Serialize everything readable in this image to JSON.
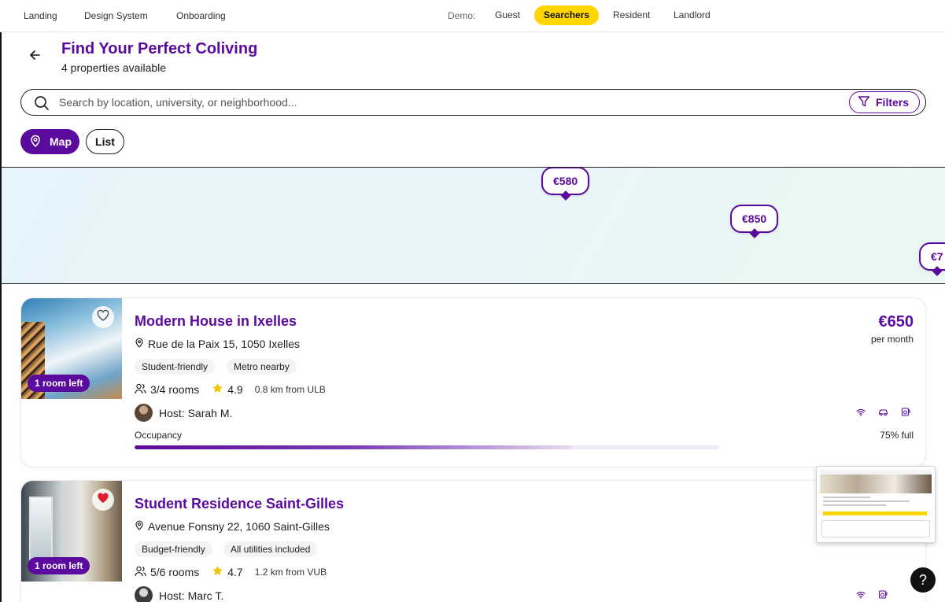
{
  "topnav": {
    "links": [
      "Landing",
      "Design System",
      "Onboarding"
    ],
    "demo_label": "Demo:",
    "demo_items": [
      "Guest",
      "Searchers",
      "Resident",
      "Landlord"
    ],
    "active_demo": "Searchers"
  },
  "header": {
    "title": "Find Your Perfect Coliving",
    "subtitle": "4 properties available"
  },
  "search": {
    "placeholder": "Search by location, university, or neighborhood...",
    "value": "",
    "filters_label": "Filters"
  },
  "view_toggle": {
    "map_label": "Map",
    "list_label": "List",
    "active": "Map"
  },
  "map": {
    "price_pins": [
      "€580",
      "€850",
      "€7"
    ]
  },
  "properties": [
    {
      "name": "Modern House in Ixelles",
      "address": "Rue de la Paix 15, 1050 Ixelles",
      "tags": [
        "Student-friendly",
        "Metro nearby"
      ],
      "rooms": "3/4 rooms",
      "rating": "4.9",
      "distance": "0.8 km from ULB",
      "host": "Host: Sarah M.",
      "price": "€650",
      "price_unit": "per month",
      "badge": "1 room left",
      "favorited": false,
      "amenities": [
        "wifi-icon",
        "car-icon",
        "washer-icon"
      ],
      "occupancy_label": "Occupancy",
      "occupancy_text": "75% full",
      "occupancy_fraction": 0.75
    },
    {
      "name": "Student Residence Saint-Gilles",
      "address": "Avenue Fonsny 22, 1060 Saint-Gilles",
      "tags": [
        "Budget-friendly",
        "All utilities included"
      ],
      "rooms": "5/6 rooms",
      "rating": "4.7",
      "distance": "1.2 km from VUB",
      "host": "Host: Marc T.",
      "badge": "1 room left",
      "favorited": true,
      "amenities": [
        "wifi-icon",
        "washer-icon"
      ]
    }
  ],
  "help_label": "?",
  "colors": {
    "brand": "#5b0a9e",
    "accent": "#ffd500",
    "favorite": "#e11d2f"
  }
}
